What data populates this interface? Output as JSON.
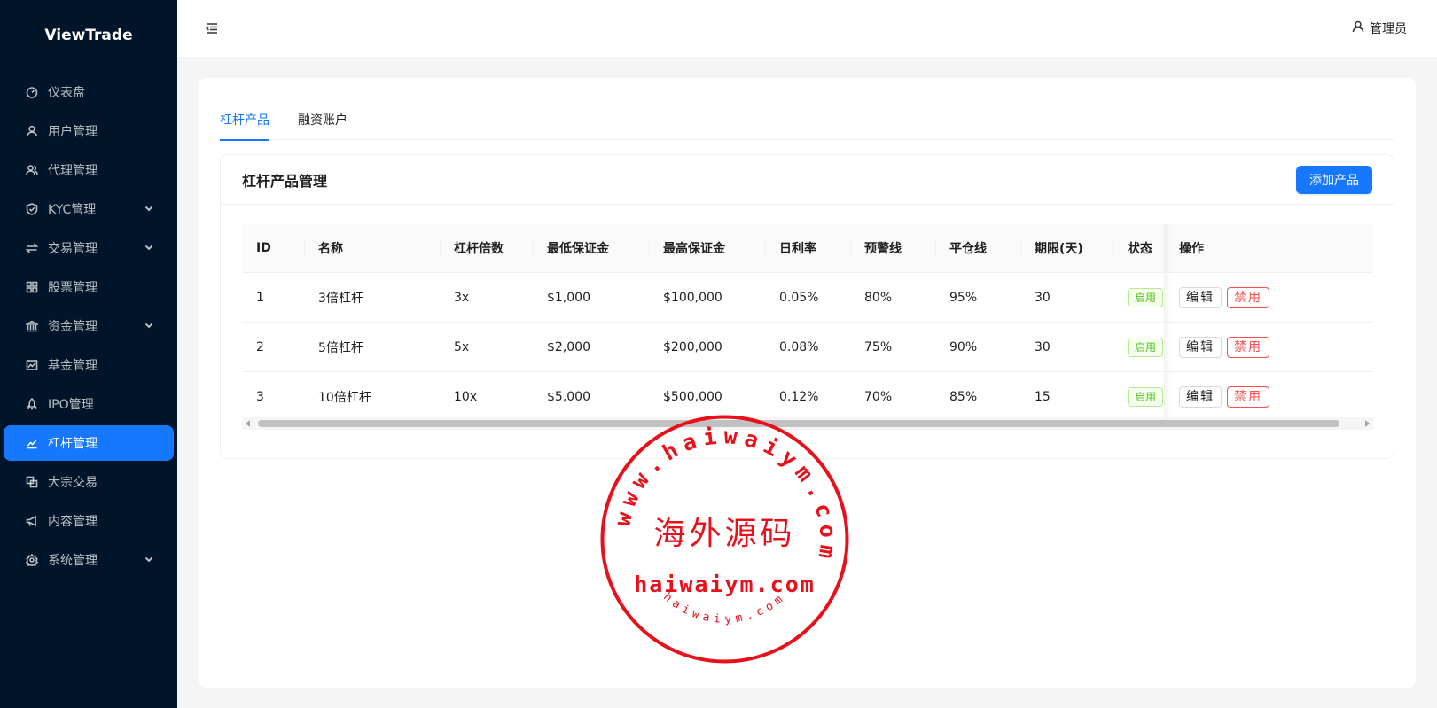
{
  "app": {
    "title": "ViewTrade"
  },
  "sidebar": {
    "items": [
      {
        "label": "仪表盘",
        "icon": "dashboard-icon",
        "expandable": false
      },
      {
        "label": "用户管理",
        "icon": "user-icon",
        "expandable": false
      },
      {
        "label": "代理管理",
        "icon": "team-icon",
        "expandable": false
      },
      {
        "label": "KYC管理",
        "icon": "shield-icon",
        "expandable": true
      },
      {
        "label": "交易管理",
        "icon": "swap-icon",
        "expandable": true
      },
      {
        "label": "股票管理",
        "icon": "grid-icon",
        "expandable": false
      },
      {
        "label": "资金管理",
        "icon": "bank-icon",
        "expandable": true
      },
      {
        "label": "基金管理",
        "icon": "fund-icon",
        "expandable": false
      },
      {
        "label": "IPO管理",
        "icon": "rocket-icon",
        "expandable": false
      },
      {
        "label": "杠杆管理",
        "icon": "line-chart-icon",
        "expandable": false,
        "active": true
      },
      {
        "label": "大宗交易",
        "icon": "block-icon",
        "expandable": false
      },
      {
        "label": "内容管理",
        "icon": "notification-icon",
        "expandable": false
      },
      {
        "label": "系统管理",
        "icon": "setting-icon",
        "expandable": true
      }
    ]
  },
  "header": {
    "user_label": "管理员"
  },
  "tabs": [
    {
      "label": "杠杆产品",
      "active": true
    },
    {
      "label": "融资账户",
      "active": false
    }
  ],
  "card": {
    "title": "杠杆产品管理",
    "add_button": "添加产品"
  },
  "table": {
    "columns": [
      "ID",
      "名称",
      "杠杆倍数",
      "最低保证金",
      "最高保证金",
      "日利率",
      "预警线",
      "平仓线",
      "期限(天)",
      "状态",
      "操作"
    ],
    "rows": [
      {
        "id": "1",
        "name": "3倍杠杆",
        "leverage": "3x",
        "min_margin": "$1,000",
        "max_margin": "$100,000",
        "daily_rate": "0.05%",
        "warning_line": "80%",
        "liquidation_line": "95%",
        "term": "30",
        "status": "启用",
        "edit": "编辑",
        "disable": "禁用"
      },
      {
        "id": "2",
        "name": "5倍杠杆",
        "leverage": "5x",
        "min_margin": "$2,000",
        "max_margin": "$200,000",
        "daily_rate": "0.08%",
        "warning_line": "75%",
        "liquidation_line": "90%",
        "term": "30",
        "status": "启用",
        "edit": "编辑",
        "disable": "禁用"
      },
      {
        "id": "3",
        "name": "10倍杠杆",
        "leverage": "10x",
        "min_margin": "$5,000",
        "max_margin": "$500,000",
        "daily_rate": "0.12%",
        "warning_line": "70%",
        "liquidation_line": "85%",
        "term": "15",
        "status": "启用",
        "edit": "编辑",
        "disable": "禁用"
      }
    ]
  },
  "watermark": {
    "ring_text": "www.haiwaiym.com",
    "center_text": "海外源码",
    "domain_text": "haiwaiym.com",
    "bottom_text": "haiwaiym.com",
    "color": "#e8101a"
  },
  "colors": {
    "primary": "#1677ff",
    "sidebar_bg": "#001529",
    "danger": "#ff4d4f",
    "success": "#52c41a"
  }
}
